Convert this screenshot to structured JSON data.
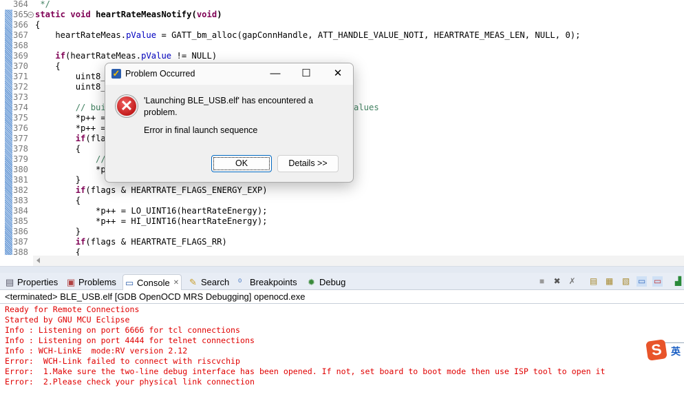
{
  "editor": {
    "lines": [
      {
        "n": "364",
        "seg": [
          [
            " */",
            "cm"
          ]
        ]
      },
      {
        "n": "365",
        "fold": true,
        "seg": [
          [
            "static",
            "kw"
          ],
          [
            " ",
            ""
          ],
          [
            "void",
            "kw"
          ],
          [
            " heartRateMeasNotify(",
            ""
          ],
          [
            "void",
            "kw"
          ],
          [
            ")",
            ""
          ]
        ],
        "bold": true
      },
      {
        "n": "366",
        "seg": [
          [
            "{",
            ""
          ]
        ]
      },
      {
        "n": "367",
        "seg": [
          [
            "    heartRateMeas.",
            ""
          ],
          [
            "pValue",
            "fld"
          ],
          [
            " = GATT_bm_alloc(gapConnHandle, ATT_HANDLE_VALUE_NOTI, HEARTRATE_MEAS_LEN, NULL, 0);",
            ""
          ]
        ]
      },
      {
        "n": "368",
        "seg": []
      },
      {
        "n": "369",
        "seg": [
          [
            "    ",
            ""
          ],
          [
            "if",
            "kw"
          ],
          [
            "(heartRateMeas.",
            ""
          ],
          [
            "pValue",
            "fld"
          ],
          [
            " != NULL)",
            ""
          ]
        ]
      },
      {
        "n": "370",
        "seg": [
          [
            "    {",
            ""
          ]
        ]
      },
      {
        "n": "371",
        "seg": [
          [
            "        uint8_t",
            ""
          ]
        ]
      },
      {
        "n": "372",
        "seg": [
          [
            "        uint8_t",
            ""
          ]
        ]
      },
      {
        "n": "373",
        "seg": []
      },
      {
        "n": "374",
        "seg": [
          [
            "        // buil",
            "cm"
          ]
        ],
        "right": "alues"
      },
      {
        "n": "375",
        "seg": [
          [
            "        *p++ =",
            ""
          ]
        ]
      },
      {
        "n": "376",
        "seg": [
          [
            "        *p++ =",
            ""
          ]
        ]
      },
      {
        "n": "377",
        "seg": [
          [
            "        ",
            ""
          ],
          [
            "if",
            "kw"
          ],
          [
            "(flag",
            ""
          ]
        ]
      },
      {
        "n": "378",
        "seg": [
          [
            "        {",
            ""
          ]
        ]
      },
      {
        "n": "379",
        "seg": [
          [
            "            //",
            "cm"
          ]
        ]
      },
      {
        "n": "380",
        "seg": [
          [
            "            *p-",
            ""
          ]
        ]
      },
      {
        "n": "381",
        "seg": [
          [
            "        }",
            ""
          ]
        ]
      },
      {
        "n": "382",
        "seg": [
          [
            "        ",
            ""
          ],
          [
            "if",
            "kw"
          ],
          [
            "(flags & HEARTRATE_FLAGS_ENERGY_EXP)",
            ""
          ]
        ]
      },
      {
        "n": "383",
        "seg": [
          [
            "        {",
            ""
          ]
        ]
      },
      {
        "n": "384",
        "seg": [
          [
            "            *p++ = LO_UINT16(heartRateEnergy);",
            ""
          ]
        ]
      },
      {
        "n": "385",
        "seg": [
          [
            "            *p++ = HI_UINT16(heartRateEnergy);",
            ""
          ]
        ]
      },
      {
        "n": "386",
        "seg": [
          [
            "        }",
            ""
          ]
        ]
      },
      {
        "n": "387",
        "seg": [
          [
            "        ",
            ""
          ],
          [
            "if",
            "kw"
          ],
          [
            "(flags & HEARTRATE_FLAGS_RR)",
            ""
          ]
        ]
      },
      {
        "n": "388",
        "seg": [
          [
            "        {",
            ""
          ]
        ]
      }
    ]
  },
  "tabs": [
    {
      "label": "Properties",
      "icon": "properties-icon"
    },
    {
      "label": "Problems",
      "icon": "problems-icon"
    },
    {
      "label": "Console",
      "icon": "console-icon",
      "active": true,
      "close": "✕"
    },
    {
      "label": "Search",
      "icon": "search-icon"
    },
    {
      "label": "Breakpoints",
      "icon": "breakpoints-icon"
    },
    {
      "label": "Debug",
      "icon": "debug-icon"
    }
  ],
  "console": {
    "header": "<terminated> BLE_USB.elf [GDB OpenOCD MRS Debugging] openocd.exe",
    "lines": [
      "Ready for Remote Connections",
      "Started by GNU MCU Eclipse",
      "Info : Listening on port 6666 for tcl connections",
      "Info : Listening on port 4444 for telnet connections",
      "Info : WCH-LinkE  mode:RV version 2.12",
      "Error:  WCH-Link failed to connect with riscvchip",
      "Error:  1.Make sure the two-line debug interface has been opened. If not, set board to boot mode then use ISP tool to open it",
      "Error:  2.Please check your physical link connection"
    ],
    "color": "#e00000"
  },
  "dialog": {
    "title": "Problem Occurred",
    "message": "'Launching BLE_USB.elf' has encountered a problem.",
    "detail": "Error in final launch sequence",
    "ok": "OK",
    "details": "Details >>"
  },
  "ime": {
    "label": "英"
  }
}
